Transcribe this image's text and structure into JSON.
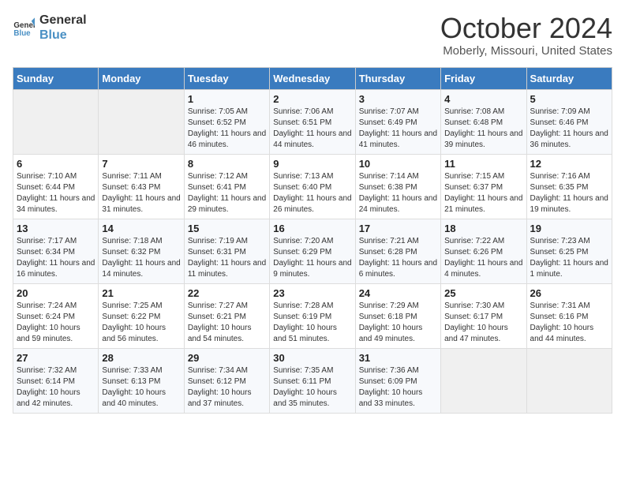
{
  "header": {
    "logo_line1": "General",
    "logo_line2": "Blue",
    "month": "October 2024",
    "location": "Moberly, Missouri, United States"
  },
  "days_of_week": [
    "Sunday",
    "Monday",
    "Tuesday",
    "Wednesday",
    "Thursday",
    "Friday",
    "Saturday"
  ],
  "weeks": [
    [
      {
        "day": "",
        "sunrise": "",
        "sunset": "",
        "daylight": ""
      },
      {
        "day": "",
        "sunrise": "",
        "sunset": "",
        "daylight": ""
      },
      {
        "day": "1",
        "sunrise": "Sunrise: 7:05 AM",
        "sunset": "Sunset: 6:52 PM",
        "daylight": "Daylight: 11 hours and 46 minutes."
      },
      {
        "day": "2",
        "sunrise": "Sunrise: 7:06 AM",
        "sunset": "Sunset: 6:51 PM",
        "daylight": "Daylight: 11 hours and 44 minutes."
      },
      {
        "day": "3",
        "sunrise": "Sunrise: 7:07 AM",
        "sunset": "Sunset: 6:49 PM",
        "daylight": "Daylight: 11 hours and 41 minutes."
      },
      {
        "day": "4",
        "sunrise": "Sunrise: 7:08 AM",
        "sunset": "Sunset: 6:48 PM",
        "daylight": "Daylight: 11 hours and 39 minutes."
      },
      {
        "day": "5",
        "sunrise": "Sunrise: 7:09 AM",
        "sunset": "Sunset: 6:46 PM",
        "daylight": "Daylight: 11 hours and 36 minutes."
      }
    ],
    [
      {
        "day": "6",
        "sunrise": "Sunrise: 7:10 AM",
        "sunset": "Sunset: 6:44 PM",
        "daylight": "Daylight: 11 hours and 34 minutes."
      },
      {
        "day": "7",
        "sunrise": "Sunrise: 7:11 AM",
        "sunset": "Sunset: 6:43 PM",
        "daylight": "Daylight: 11 hours and 31 minutes."
      },
      {
        "day": "8",
        "sunrise": "Sunrise: 7:12 AM",
        "sunset": "Sunset: 6:41 PM",
        "daylight": "Daylight: 11 hours and 29 minutes."
      },
      {
        "day": "9",
        "sunrise": "Sunrise: 7:13 AM",
        "sunset": "Sunset: 6:40 PM",
        "daylight": "Daylight: 11 hours and 26 minutes."
      },
      {
        "day": "10",
        "sunrise": "Sunrise: 7:14 AM",
        "sunset": "Sunset: 6:38 PM",
        "daylight": "Daylight: 11 hours and 24 minutes."
      },
      {
        "day": "11",
        "sunrise": "Sunrise: 7:15 AM",
        "sunset": "Sunset: 6:37 PM",
        "daylight": "Daylight: 11 hours and 21 minutes."
      },
      {
        "day": "12",
        "sunrise": "Sunrise: 7:16 AM",
        "sunset": "Sunset: 6:35 PM",
        "daylight": "Daylight: 11 hours and 19 minutes."
      }
    ],
    [
      {
        "day": "13",
        "sunrise": "Sunrise: 7:17 AM",
        "sunset": "Sunset: 6:34 PM",
        "daylight": "Daylight: 11 hours and 16 minutes."
      },
      {
        "day": "14",
        "sunrise": "Sunrise: 7:18 AM",
        "sunset": "Sunset: 6:32 PM",
        "daylight": "Daylight: 11 hours and 14 minutes."
      },
      {
        "day": "15",
        "sunrise": "Sunrise: 7:19 AM",
        "sunset": "Sunset: 6:31 PM",
        "daylight": "Daylight: 11 hours and 11 minutes."
      },
      {
        "day": "16",
        "sunrise": "Sunrise: 7:20 AM",
        "sunset": "Sunset: 6:29 PM",
        "daylight": "Daylight: 11 hours and 9 minutes."
      },
      {
        "day": "17",
        "sunrise": "Sunrise: 7:21 AM",
        "sunset": "Sunset: 6:28 PM",
        "daylight": "Daylight: 11 hours and 6 minutes."
      },
      {
        "day": "18",
        "sunrise": "Sunrise: 7:22 AM",
        "sunset": "Sunset: 6:26 PM",
        "daylight": "Daylight: 11 hours and 4 minutes."
      },
      {
        "day": "19",
        "sunrise": "Sunrise: 7:23 AM",
        "sunset": "Sunset: 6:25 PM",
        "daylight": "Daylight: 11 hours and 1 minute."
      }
    ],
    [
      {
        "day": "20",
        "sunrise": "Sunrise: 7:24 AM",
        "sunset": "Sunset: 6:24 PM",
        "daylight": "Daylight: 10 hours and 59 minutes."
      },
      {
        "day": "21",
        "sunrise": "Sunrise: 7:25 AM",
        "sunset": "Sunset: 6:22 PM",
        "daylight": "Daylight: 10 hours and 56 minutes."
      },
      {
        "day": "22",
        "sunrise": "Sunrise: 7:27 AM",
        "sunset": "Sunset: 6:21 PM",
        "daylight": "Daylight: 10 hours and 54 minutes."
      },
      {
        "day": "23",
        "sunrise": "Sunrise: 7:28 AM",
        "sunset": "Sunset: 6:19 PM",
        "daylight": "Daylight: 10 hours and 51 minutes."
      },
      {
        "day": "24",
        "sunrise": "Sunrise: 7:29 AM",
        "sunset": "Sunset: 6:18 PM",
        "daylight": "Daylight: 10 hours and 49 minutes."
      },
      {
        "day": "25",
        "sunrise": "Sunrise: 7:30 AM",
        "sunset": "Sunset: 6:17 PM",
        "daylight": "Daylight: 10 hours and 47 minutes."
      },
      {
        "day": "26",
        "sunrise": "Sunrise: 7:31 AM",
        "sunset": "Sunset: 6:16 PM",
        "daylight": "Daylight: 10 hours and 44 minutes."
      }
    ],
    [
      {
        "day": "27",
        "sunrise": "Sunrise: 7:32 AM",
        "sunset": "Sunset: 6:14 PM",
        "daylight": "Daylight: 10 hours and 42 minutes."
      },
      {
        "day": "28",
        "sunrise": "Sunrise: 7:33 AM",
        "sunset": "Sunset: 6:13 PM",
        "daylight": "Daylight: 10 hours and 40 minutes."
      },
      {
        "day": "29",
        "sunrise": "Sunrise: 7:34 AM",
        "sunset": "Sunset: 6:12 PM",
        "daylight": "Daylight: 10 hours and 37 minutes."
      },
      {
        "day": "30",
        "sunrise": "Sunrise: 7:35 AM",
        "sunset": "Sunset: 6:11 PM",
        "daylight": "Daylight: 10 hours and 35 minutes."
      },
      {
        "day": "31",
        "sunrise": "Sunrise: 7:36 AM",
        "sunset": "Sunset: 6:09 PM",
        "daylight": "Daylight: 10 hours and 33 minutes."
      },
      {
        "day": "",
        "sunrise": "",
        "sunset": "",
        "daylight": ""
      },
      {
        "day": "",
        "sunrise": "",
        "sunset": "",
        "daylight": ""
      }
    ]
  ]
}
